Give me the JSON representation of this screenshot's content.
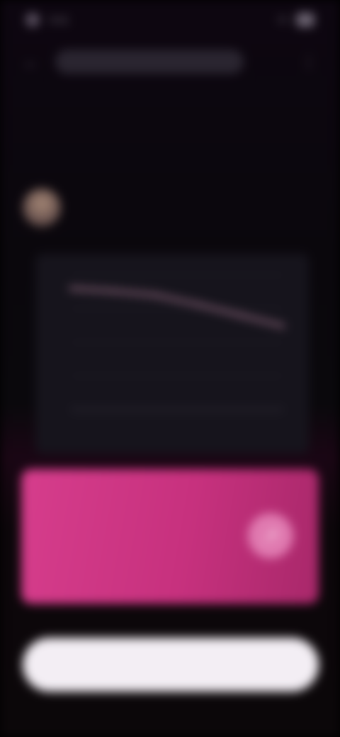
{
  "status_bar": {
    "time": "9:41",
    "signal": "5G",
    "icons": [
      "notification-dot-icon",
      "signal-icon",
      "battery-icon"
    ]
  },
  "app_bar": {
    "back_icon": "back-arrow-icon",
    "url": "",
    "more_icon": "more-vert-icon"
  },
  "article": {
    "headline": "",
    "author": "",
    "meta": ""
  },
  "chart_card": {
    "icons": []
  },
  "promo": {
    "title": "",
    "icon": "arrow-icon"
  },
  "footer": {
    "button_label": ""
  },
  "colors": {
    "background": "#0b0709",
    "accent_pink": "#d63d8c",
    "button": "#f3eef4",
    "chart_line": "#d89ab8"
  },
  "chart_data": {
    "type": "line",
    "title": "",
    "xlabel": "",
    "ylabel": "",
    "grid": true,
    "series": [
      {
        "values": [
          0.9,
          0.88,
          0.85,
          0.78,
          0.7,
          0.62
        ]
      }
    ]
  }
}
